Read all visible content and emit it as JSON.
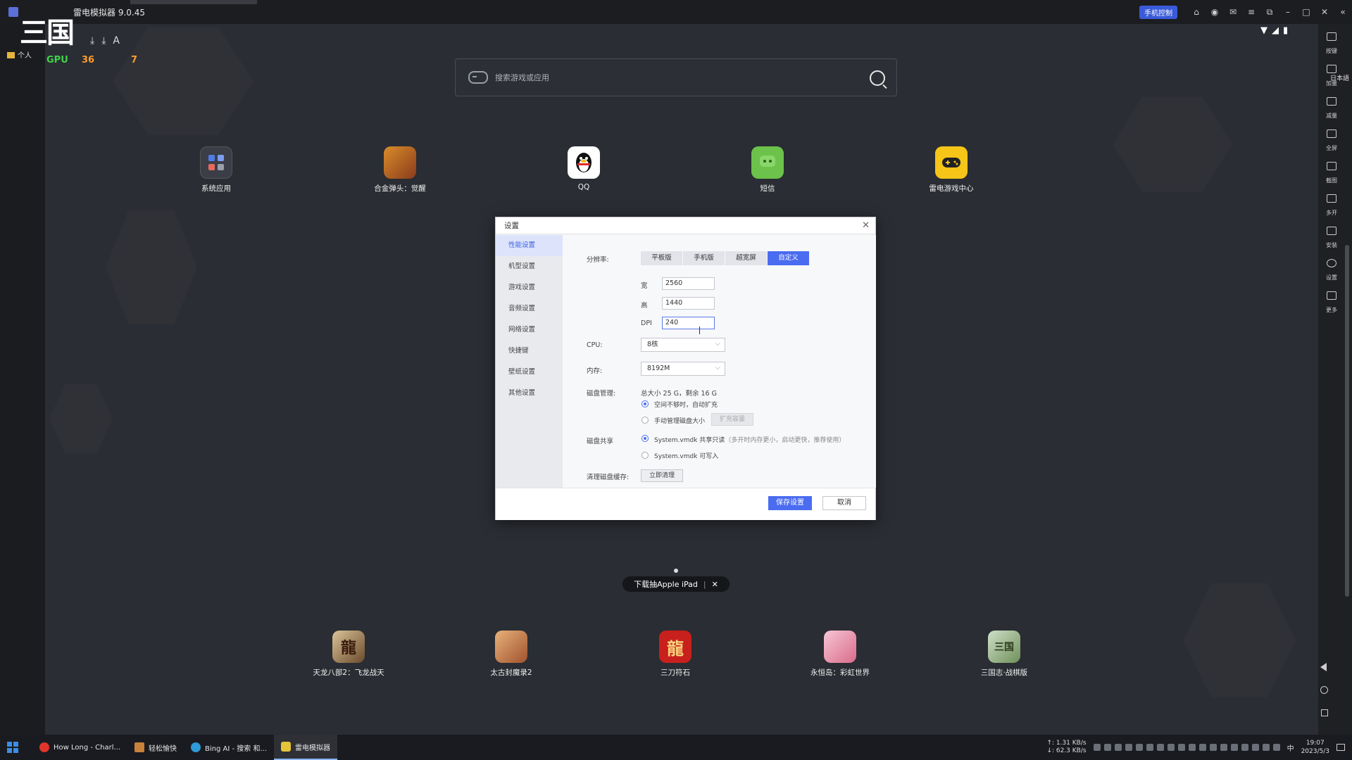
{
  "window": {
    "title": "雷电模拟器 9.0.45",
    "phone_control": "手机控制"
  },
  "hud": {
    "logo": "三国",
    "gpu_label": "GPU",
    "value1": "36",
    "value2": "7",
    "folder": "个人"
  },
  "search": {
    "placeholder": "搜索游戏或应用"
  },
  "top_apps": [
    {
      "label": "系统应用"
    },
    {
      "label": "合金弹头：觉醒"
    },
    {
      "label": "QQ"
    },
    {
      "label": "短信"
    },
    {
      "label": "雷电游戏中心"
    }
  ],
  "bottom_apps": [
    {
      "label": "天龙八部2：飞龙战天"
    },
    {
      "label": "太古封魔录2"
    },
    {
      "label": "三刀符石"
    },
    {
      "label": "永恒岛：彩虹世界"
    },
    {
      "label": "三国志·战棋版"
    }
  ],
  "promo": {
    "text": "下载抽Apple iPad",
    "close": "✕"
  },
  "toolbar": [
    {
      "label": "按键"
    },
    {
      "label": "加量"
    },
    {
      "label": "减量"
    },
    {
      "label": "全屏"
    },
    {
      "label": "截图"
    },
    {
      "label": "多开"
    },
    {
      "label": "安装"
    },
    {
      "label": "设置"
    },
    {
      "label": "更多"
    }
  ],
  "right_edge_text": "日本語",
  "dialog": {
    "title": "设置",
    "nav": [
      {
        "label": "性能设置"
      },
      {
        "label": "机型设置"
      },
      {
        "label": "游戏设置"
      },
      {
        "label": "音频设置"
      },
      {
        "label": "网络设置"
      },
      {
        "label": "快捷键"
      },
      {
        "label": "壁纸设置"
      },
      {
        "label": "其他设置"
      }
    ],
    "resolution_label": "分辨率:",
    "resolution_options": [
      "平板版",
      "手机版",
      "超宽屏",
      "自定义"
    ],
    "width_label": "宽",
    "width_value": "2560",
    "height_label": "高",
    "height_value": "1440",
    "dpi_label": "DPI",
    "dpi_value": "240",
    "cpu_label": "CPU:",
    "cpu_value": "8核",
    "memory_label": "内存:",
    "memory_value": "8192M",
    "disk_label": "磁盘管理:",
    "disk_info": "总大小 25 G，剩余 16 G",
    "disk_opt1": "空间不够时，自动扩充",
    "disk_opt2": "手动管理磁盘大小",
    "expand_btn": "扩充容量",
    "share_label": "磁盘共享",
    "share_opt1": "System.vmdk 共享只读",
    "share_opt1_hint": "（多开时内存更小，启动更快，推荐使用）",
    "share_opt2": "System.vmdk 可写入",
    "cache_label": "清理磁盘缓存:",
    "cache_btn": "立即清理",
    "save_btn": "保存设置",
    "cancel_btn": "取消"
  },
  "taskbar": {
    "tasks": [
      {
        "label": "How Long - Charl...",
        "color": "#e0352b"
      },
      {
        "label": "轻松愉快",
        "color": "#c9823a"
      },
      {
        "label": "Bing AI - 搜索 和...",
        "color": "#2e9ad6"
      },
      {
        "label": "雷电模拟器",
        "color": "#e5c338"
      }
    ],
    "net_up": "↑: 1.31 KB/s",
    "net_down": "↓: 62.3 KB/s",
    "ime": "中",
    "time": "19:07",
    "date": "2023/5/3"
  }
}
